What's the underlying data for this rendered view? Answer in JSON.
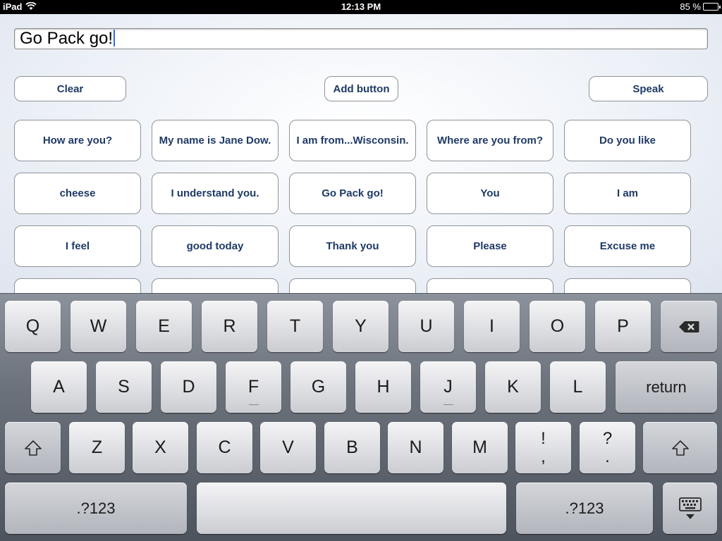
{
  "status_bar": {
    "device": "iPad",
    "time": "12:13 PM",
    "battery": "85 %",
    "battery_level": 0.85
  },
  "text_field": {
    "value": "Go Pack go!"
  },
  "toolbar": {
    "clear_label": "Clear",
    "add_label": "Add button",
    "speak_label": "Speak"
  },
  "phrases": [
    "How are you?",
    "My name is Jane Dow.",
    "I am from...Wisconsin.",
    "Where are you from?",
    "Do you like",
    "cheese",
    "I understand you.",
    "Go Pack go!",
    "You",
    "I am",
    "I feel",
    "good today",
    "Thank you",
    "Please",
    "Excuse me"
  ],
  "keyboard": {
    "row1": [
      "Q",
      "W",
      "E",
      "R",
      "T",
      "Y",
      "U",
      "I",
      "O",
      "P"
    ],
    "row2": [
      "A",
      "S",
      "D",
      "F",
      "G",
      "H",
      "J",
      "K",
      "L"
    ],
    "return_label": "return",
    "row3": [
      "Z",
      "X",
      "C",
      "V",
      "B",
      "N",
      "M"
    ],
    "punct1_top": "!",
    "punct1_bottom": ",",
    "punct2_top": "?",
    "punct2_bottom": ".",
    "numbers_label": ".?123",
    "icons": {
      "backspace": "backspace-icon",
      "shift": "shift-icon",
      "hide": "keyboard-hide-icon"
    }
  },
  "colors": {
    "button_text": "#1f3a66",
    "caret": "#2f6fe0"
  }
}
